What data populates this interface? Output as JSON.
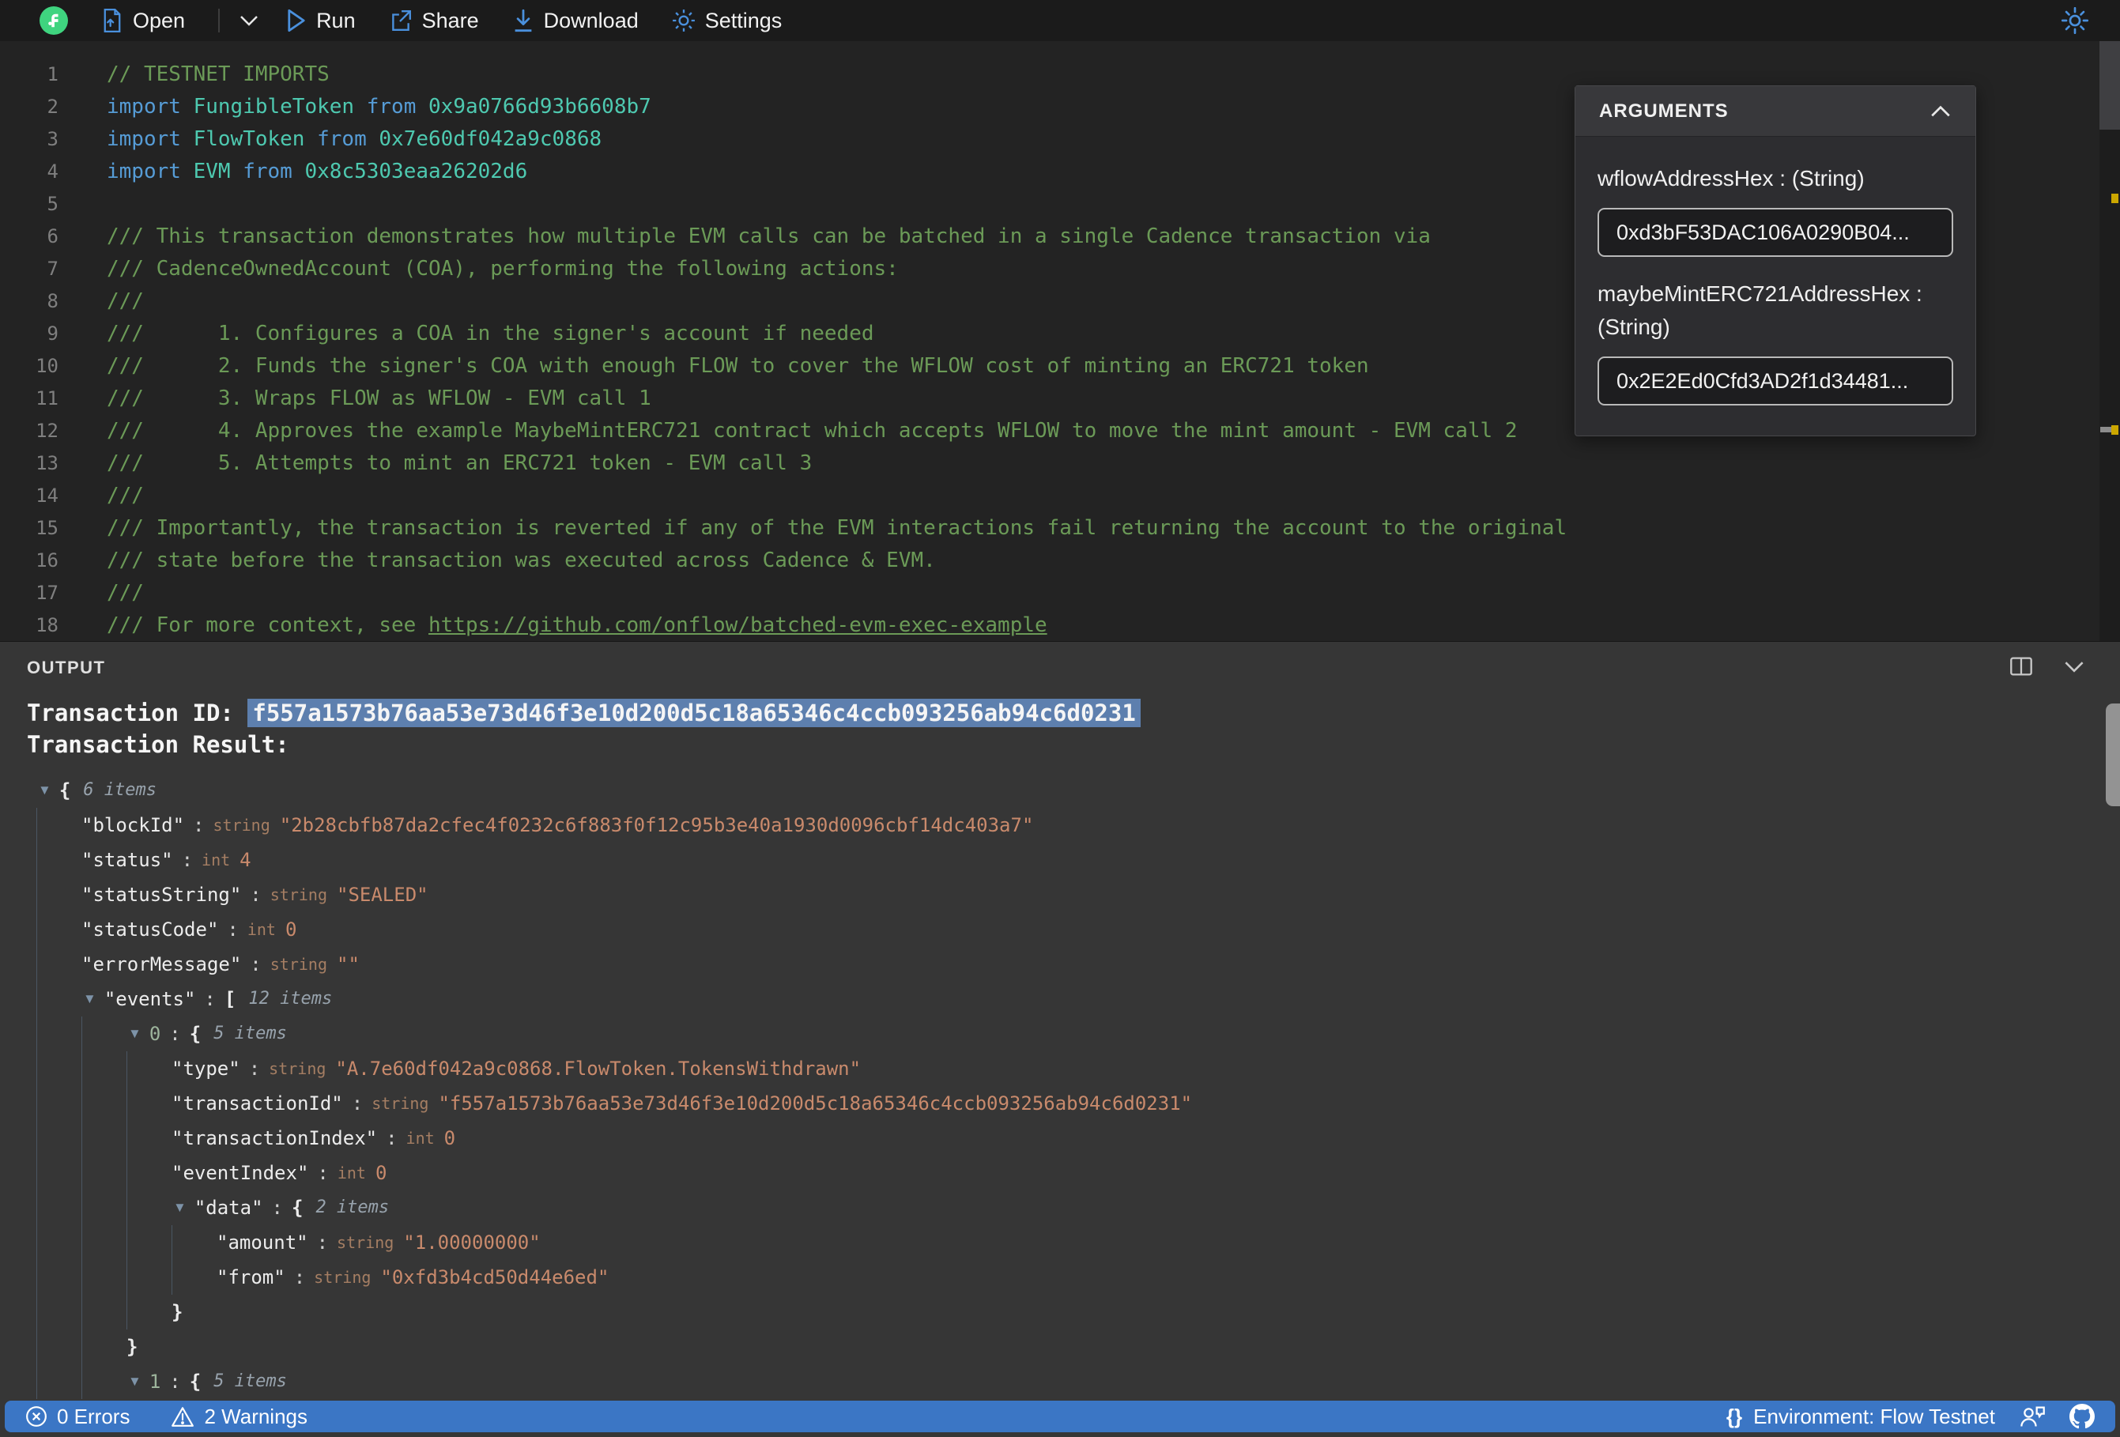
{
  "toolbar": {
    "open_label": "Open",
    "run_label": "Run",
    "share_label": "Share",
    "download_label": "Download",
    "settings_label": "Settings"
  },
  "editor": {
    "lines": [
      {
        "n": 1,
        "tokens": [
          {
            "t": "comment",
            "s": "// TESTNET IMPORTS"
          }
        ]
      },
      {
        "n": 2,
        "tokens": [
          {
            "t": "kw",
            "s": "import"
          },
          {
            "t": "type",
            "s": " FungibleToken"
          },
          {
            "t": "kw",
            "s": " from"
          },
          {
            "t": "type",
            "s": " 0x9a0766d93b6608b7"
          }
        ]
      },
      {
        "n": 3,
        "tokens": [
          {
            "t": "kw",
            "s": "import"
          },
          {
            "t": "type",
            "s": " FlowToken"
          },
          {
            "t": "kw",
            "s": " from"
          },
          {
            "t": "type",
            "s": " 0x7e60df042a9c0868"
          }
        ]
      },
      {
        "n": 4,
        "tokens": [
          {
            "t": "kw",
            "s": "import"
          },
          {
            "t": "type",
            "s": " EVM"
          },
          {
            "t": "kw",
            "s": " from"
          },
          {
            "t": "type",
            "s": " 0x8c5303eaa26202d6"
          }
        ]
      },
      {
        "n": 5,
        "tokens": []
      },
      {
        "n": 6,
        "tokens": [
          {
            "t": "comment",
            "s": "/// This transaction demonstrates how multiple EVM calls can be batched in a single Cadence transaction via"
          }
        ]
      },
      {
        "n": 7,
        "tokens": [
          {
            "t": "comment",
            "s": "/// CadenceOwnedAccount (COA), performing the following actions:"
          }
        ]
      },
      {
        "n": 8,
        "tokens": [
          {
            "t": "comment",
            "s": "///"
          }
        ]
      },
      {
        "n": 9,
        "tokens": [
          {
            "t": "comment",
            "s": "///      1. Configures a COA in the signer's account if needed"
          }
        ]
      },
      {
        "n": 10,
        "tokens": [
          {
            "t": "comment",
            "s": "///      2. Funds the signer's COA with enough FLOW to cover the WFLOW cost of minting an ERC721 token"
          }
        ]
      },
      {
        "n": 11,
        "tokens": [
          {
            "t": "comment",
            "s": "///      3. Wraps FLOW as WFLOW - EVM call 1"
          }
        ]
      },
      {
        "n": 12,
        "tokens": [
          {
            "t": "comment",
            "s": "///      4. Approves the example MaybeMintERC721 contract which accepts WFLOW to move the mint amount - EVM call 2"
          }
        ]
      },
      {
        "n": 13,
        "tokens": [
          {
            "t": "comment",
            "s": "///      5. Attempts to mint an ERC721 token - EVM call 3"
          }
        ]
      },
      {
        "n": 14,
        "tokens": [
          {
            "t": "comment",
            "s": "///"
          }
        ]
      },
      {
        "n": 15,
        "tokens": [
          {
            "t": "comment",
            "s": "/// Importantly, the transaction is reverted if any of the EVM interactions fail returning the account to the original"
          }
        ]
      },
      {
        "n": 16,
        "tokens": [
          {
            "t": "comment",
            "s": "/// state before the transaction was executed across Cadence & EVM."
          }
        ]
      },
      {
        "n": 17,
        "tokens": [
          {
            "t": "comment",
            "s": "///"
          }
        ]
      },
      {
        "n": 18,
        "tokens": [
          {
            "t": "comment",
            "s": "/// For more context, see "
          },
          {
            "t": "link",
            "s": "https://github.com/onflow/batched-evm-exec-example"
          }
        ]
      }
    ]
  },
  "arguments_panel": {
    "title": "ARGUMENTS",
    "fields": [
      {
        "label": "wflowAddressHex : (String)",
        "value": "0xd3bF53DAC106A0290B04..."
      },
      {
        "label": "maybeMintERC721AddressHex : (String)",
        "value": "0x2E2Ed0Cfd3AD2f1d34481..."
      }
    ]
  },
  "output": {
    "title": "OUTPUT",
    "transaction_id_label": "Transaction ID:",
    "transaction_id": "f557a1573b76aa53e73d46f3e10d200d5c18a65346c4ccb093256ab94c6d0231",
    "transaction_result_label": "Transaction Result:",
    "json_rows": [
      {
        "indent": 0,
        "arrow": true,
        "open": "{",
        "count": "6 items"
      },
      {
        "indent": 1,
        "key": "blockId",
        "type": "string",
        "value": "\"2b28cbfb87da2cfec4f0232c6f883f0f12c95b3e40a1930d0096cbf14dc403a7\""
      },
      {
        "indent": 1,
        "key": "status",
        "type": "int",
        "value": "4"
      },
      {
        "indent": 1,
        "key": "statusString",
        "type": "string",
        "value": "\"SEALED\""
      },
      {
        "indent": 1,
        "key": "statusCode",
        "type": "int",
        "value": "0"
      },
      {
        "indent": 1,
        "key": "errorMessage",
        "type": "string",
        "value": "\"\""
      },
      {
        "indent": 1,
        "arrow": true,
        "key": "events",
        "open": "[",
        "count": "12 items"
      },
      {
        "indent": 2,
        "arrow": true,
        "index": "0",
        "open": "{",
        "count": "5 items"
      },
      {
        "indent": 3,
        "key": "type",
        "type": "string",
        "value": "\"A.7e60df042a9c0868.FlowToken.TokensWithdrawn\""
      },
      {
        "indent": 3,
        "key": "transactionId",
        "type": "string",
        "value": "\"f557a1573b76aa53e73d46f3e10d200d5c18a65346c4ccb093256ab94c6d0231\""
      },
      {
        "indent": 3,
        "key": "transactionIndex",
        "type": "int",
        "value": "0"
      },
      {
        "indent": 3,
        "key": "eventIndex",
        "type": "int",
        "value": "0"
      },
      {
        "indent": 3,
        "arrow": true,
        "key": "data",
        "open": "{",
        "count": "2 items"
      },
      {
        "indent": 4,
        "key": "amount",
        "type": "string",
        "value": "\"1.00000000\""
      },
      {
        "indent": 4,
        "key": "from",
        "type": "string",
        "value": "\"0xfd3b4cd50d44e6ed\""
      },
      {
        "indent": 3,
        "close": "}"
      },
      {
        "indent": 2,
        "close": "}"
      },
      {
        "indent": 2,
        "arrow": true,
        "index": "1",
        "open": "{",
        "count": "5 items"
      }
    ]
  },
  "statusbar": {
    "errors": "0 Errors",
    "warnings": "2 Warnings",
    "environment": "Environment: Flow Testnet",
    "braces_glyph": "{}"
  },
  "colors": {
    "accent_blue": "#4a90dd",
    "flow_green": "#3fd47f",
    "status_bar_blue": "#3b76c5",
    "selection_blue": "#5d7fae",
    "warning_yellow": "#cca700",
    "comment_green": "#6b9a57",
    "keyword_blue": "#569cd6",
    "type_teal": "#4ec9b0",
    "json_value_orange": "#c98a6c"
  }
}
